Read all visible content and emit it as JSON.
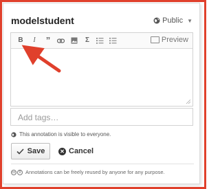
{
  "header": {
    "username": "modelstudent",
    "privacy_label": "Public",
    "privacy_icon": "globe-icon"
  },
  "editor": {
    "toolbar": {
      "bold_glyph": "B",
      "italic_glyph": "I",
      "quote_glyph": "”",
      "link_icon": "link-icon",
      "image_icon": "image-icon",
      "math_glyph": "Σ",
      "numbered_list_icon": "numbered-list-icon",
      "bulleted_list_icon": "bulleted-list-icon",
      "preview_label": "Preview"
    },
    "body_value": ""
  },
  "tags": {
    "placeholder": "Add tags…",
    "value": ""
  },
  "visibility_note": "This annotation is visible to everyone.",
  "actions": {
    "save_label": "Save",
    "cancel_label": "Cancel"
  },
  "license_text": "Annotations can be freely reused by anyone for any purpose.",
  "colors": {
    "frame_border": "#e0402c",
    "arrow": "#e0402c"
  }
}
